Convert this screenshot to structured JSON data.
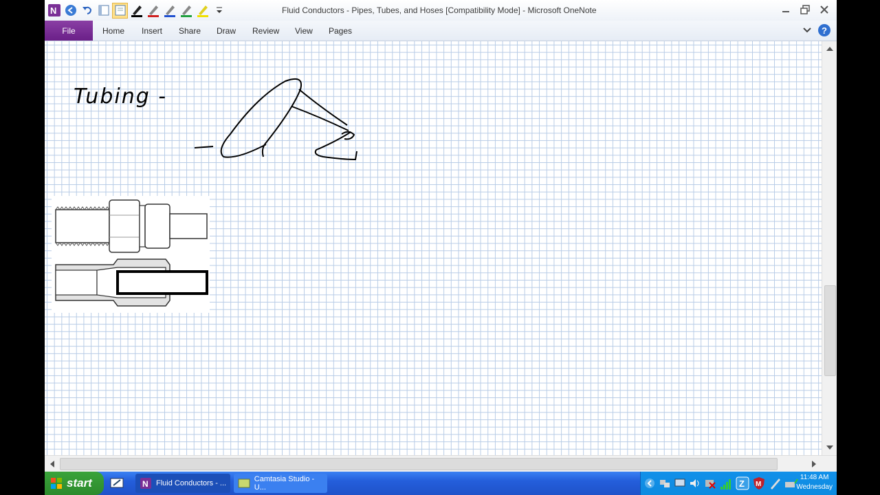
{
  "window": {
    "title": "Fluid Conductors - Pipes, Tubes, and Hoses [Compatibility Mode] - Microsoft OneNote"
  },
  "ribbon": {
    "file_label": "File",
    "tabs": [
      "Home",
      "Insert",
      "Share",
      "Draw",
      "Review",
      "View",
      "Pages"
    ]
  },
  "page": {
    "handwriting": "Tubing -"
  },
  "taskbar": {
    "start_label": "start",
    "items": [
      {
        "label": "Fluid Conductors - ..."
      },
      {
        "label": "Camtasia Studio - U..."
      }
    ],
    "clock_time": "11:48 AM",
    "clock_day": "Wednesday"
  },
  "colors": {
    "file_tab": "#7a2f96",
    "grid": "#b7cbe6",
    "taskbar": "#245edb",
    "start": "#2c8a2c"
  }
}
